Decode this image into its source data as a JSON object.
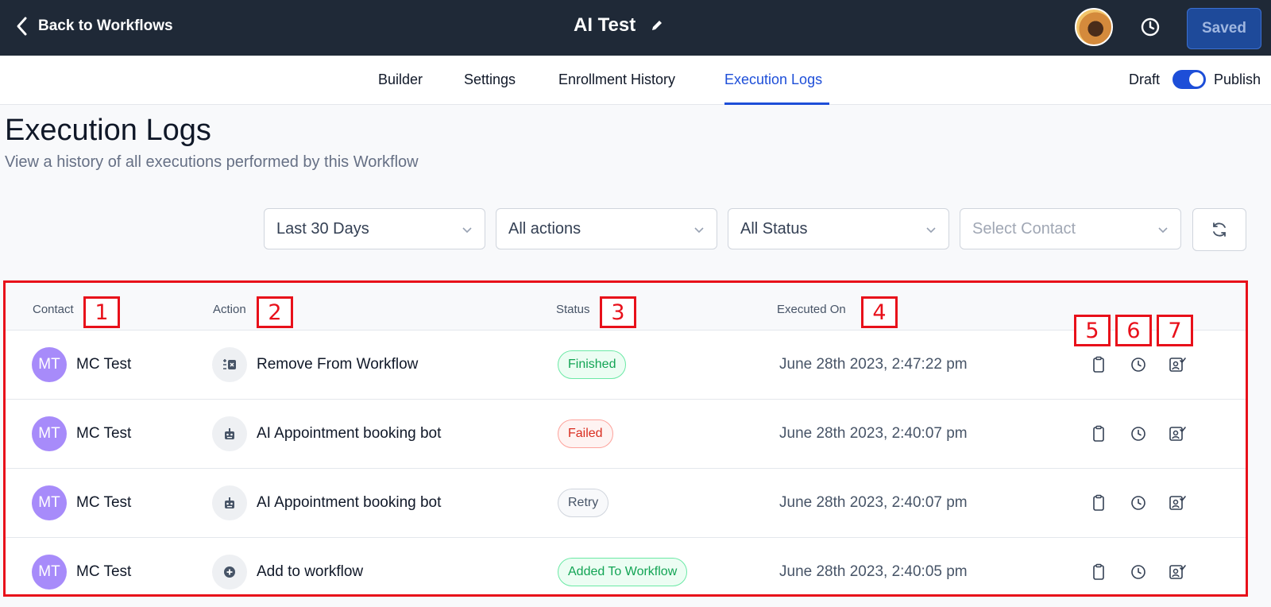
{
  "header": {
    "back_label": "Back to Workflows",
    "workflow_title": "AI Test",
    "saved_label": "Saved"
  },
  "tabs": [
    {
      "label": "Builder"
    },
    {
      "label": "Settings"
    },
    {
      "label": "Enrollment History"
    },
    {
      "label": "Execution Logs",
      "active": true
    }
  ],
  "publish_toggle": {
    "draft_label": "Draft",
    "publish_label": "Publish",
    "state": "Publish"
  },
  "page": {
    "title": "Execution Logs",
    "subtitle": "View a history of all executions performed by this Workflow"
  },
  "filters": {
    "date": "Last 30 Days",
    "actions": "All actions",
    "status": "All Status",
    "contact_placeholder": "Select Contact"
  },
  "table": {
    "columns": [
      "Contact",
      "Action",
      "Status",
      "Executed On"
    ],
    "callouts": [
      "1",
      "2",
      "3",
      "4",
      "5",
      "6",
      "7"
    ],
    "rows": [
      {
        "initials": "MT",
        "contact": "MC Test",
        "action_icon": "remove-workflow-icon",
        "action": "Remove From Workflow",
        "status": "Finished",
        "status_color": "#12a454",
        "executed_on": "June 28th 2023, 2:47:22 pm"
      },
      {
        "initials": "MT",
        "contact": "MC Test",
        "action_icon": "bot-icon",
        "action": "AI Appointment booking bot",
        "status": "Failed",
        "status_color": "#d92d20",
        "executed_on": "June 28th 2023, 2:40:07 pm"
      },
      {
        "initials": "MT",
        "contact": "MC Test",
        "action_icon": "bot-icon",
        "action": "AI Appointment booking bot",
        "status": "Retry",
        "status_color": "#475467",
        "executed_on": "June 28th 2023, 2:40:07 pm"
      },
      {
        "initials": "MT",
        "contact": "MC Test",
        "action_icon": "add-circle-icon",
        "action": "Add to workflow",
        "status": "Added To Workflow",
        "status_color": "#12a454",
        "executed_on": "June 28th 2023, 2:40:05 pm"
      }
    ]
  },
  "colors": {
    "topbar": "#1f2937",
    "accent": "#1d4ed8",
    "avatar_bg": "#a78bfa",
    "callout_red": "#e8101a"
  }
}
